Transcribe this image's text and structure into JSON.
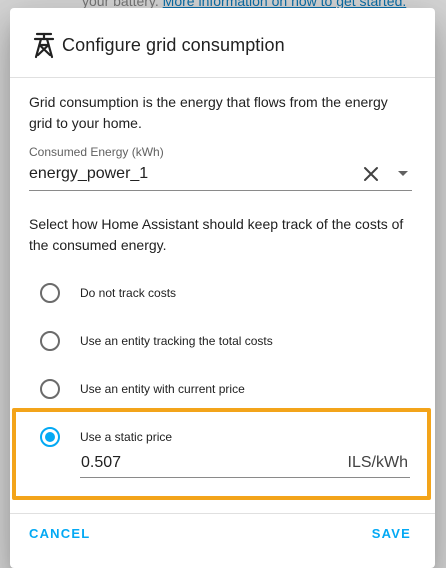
{
  "background": {
    "text": "your battery.",
    "link": "More information on how to get started."
  },
  "dialog": {
    "title": "Configure grid consumption",
    "description": "Grid consumption is the energy that flows from the energy grid to your home.",
    "entity_field": {
      "label": "Consumed Energy (kWh)",
      "value": "energy_power_1"
    },
    "select_description": "Select how Home Assistant should keep track of the costs of the consumed energy.",
    "options": [
      {
        "label": "Do not track costs",
        "checked": false
      },
      {
        "label": "Use an entity tracking the total costs",
        "checked": false
      },
      {
        "label": "Use an entity with current price",
        "checked": false
      },
      {
        "label": "Use a static price",
        "checked": true
      }
    ],
    "price": {
      "value": "0.507",
      "unit": "ILS/kWh"
    },
    "actions": {
      "cancel": "CANCEL",
      "save": "SAVE"
    }
  },
  "colors": {
    "accent": "#03a9f4",
    "highlight": "#f3a41a"
  }
}
